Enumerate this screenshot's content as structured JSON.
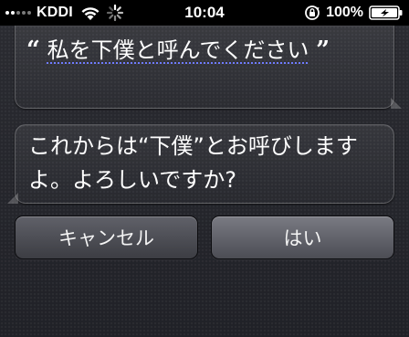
{
  "status_bar": {
    "carrier": "KDDI",
    "time": "10:04",
    "battery": "100%",
    "signal_bars": 5,
    "signal_bars_filled": 2
  },
  "conversation": {
    "user_open_quote": "“",
    "user_message": "私を下僕と呼んでください",
    "user_close_quote": "”",
    "siri_reply": "これからは“下僕”とお呼びしますよ。よろしいですか?"
  },
  "buttons": {
    "cancel_label": "キャンセル",
    "yes_label": "はい"
  },
  "colors": {
    "background": "#23242a",
    "dictation_underline": "#6f7cff"
  }
}
